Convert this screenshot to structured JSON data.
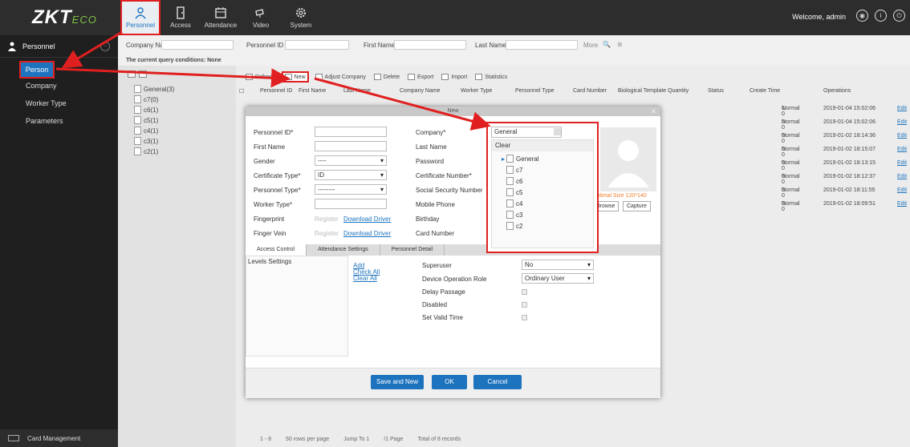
{
  "header": {
    "logo_main": "ZKT",
    "logo_eco": "ECO",
    "modules": [
      {
        "label": "Personnel",
        "icon": "person-icon"
      },
      {
        "label": "Access",
        "icon": "door-icon"
      },
      {
        "label": "Attendance",
        "icon": "calendar-icon"
      },
      {
        "label": "Video",
        "icon": "camera-icon"
      },
      {
        "label": "System",
        "icon": "gear-icon"
      }
    ],
    "welcome": "Welcome, admin"
  },
  "sidebar": {
    "title": "Personnel",
    "items": [
      {
        "label": "Person"
      },
      {
        "label": "Company"
      },
      {
        "label": "Worker Type"
      },
      {
        "label": "Parameters"
      }
    ],
    "footer": "Card Management"
  },
  "query": {
    "company_name": "Company Name",
    "personnel_id": "Personnel ID",
    "first_name": "First Name",
    "last_name": "Last Name",
    "more": "More",
    "conditions": "The current query conditions: None"
  },
  "tree": {
    "nodes": [
      "General(3)",
      "c7(0)",
      "c6(1)",
      "c5(1)",
      "c4(1)",
      "c3(1)",
      "c2(1)"
    ]
  },
  "toolbar": {
    "refresh": "Refresh",
    "new": "New",
    "adjust_company": "Adjust Company",
    "delete": "Delete",
    "export": "Export",
    "import": "Import",
    "statistics": "Statistics"
  },
  "table": {
    "headers": [
      "Personnel ID",
      "First Name",
      "Last Name",
      "Company Name",
      "Worker Type",
      "Personnel Type",
      "Card Number",
      "Biological Template Quantity",
      "Status",
      "Create Time",
      "Operations"
    ],
    "rows": [
      {
        "bio": "1  0",
        "status": "Normal",
        "time": "2019-01-04 15:02:06",
        "op": "Edit"
      },
      {
        "bio": "0  0",
        "status": "Normal",
        "time": "2019-01-04 15:02:06",
        "op": "Edit"
      },
      {
        "bio": "0  0",
        "status": "Normal",
        "time": "2019-01-02 18:14:36",
        "op": "Edit"
      },
      {
        "bio": "0  0",
        "status": "Normal",
        "time": "2019-01-02 18:15:07",
        "op": "Edit"
      },
      {
        "bio": "0  0",
        "status": "Normal",
        "time": "2019-01-02 18:13:15",
        "op": "Edit"
      },
      {
        "bio": "0  0",
        "status": "Normal",
        "time": "2019-01-02 18:12:37",
        "op": "Edit"
      },
      {
        "bio": "0  0",
        "status": "Normal",
        "time": "2019-01-02 18:11:55",
        "op": "Edit"
      },
      {
        "bio": "0  0",
        "status": "Normal",
        "time": "2019-01-02 18:09:51",
        "op": "Edit"
      }
    ]
  },
  "pager": {
    "range": "1 - 8",
    "rows": "50 rows per page",
    "jump": "Jump To",
    "page": "1",
    "pages": "/1 Page",
    "total": "Total of 8 records"
  },
  "dialog": {
    "title": "New",
    "left_labels": [
      "Personnel ID*",
      "First Name",
      "Gender",
      "Certificate Type*",
      "Personnel Type*",
      "Worker Type*",
      "Fingerprint",
      "Finger Vein"
    ],
    "gender_value": "----",
    "cert_value": "ID",
    "ptype_value": "--------",
    "register": "Register",
    "download_driver": "Download Driver",
    "right_labels": [
      "Company*",
      "Last Name",
      "Password",
      "Certificate Number*",
      "Social Security Number",
      "Mobile Phone",
      "Birthday",
      "Card Number"
    ],
    "optimal": "Optimal Size 120*140",
    "browse": "Browse",
    "capture": "Capture",
    "tabs": [
      "Access Control",
      "Attendance Settings",
      "Personnel Detail"
    ],
    "levels": "Levels Settings",
    "add": "Add",
    "check_all": "Check All",
    "clear_all": "Clear All",
    "access_labels": [
      "Superuser",
      "Device Operation Role",
      "Delay Passage",
      "Disabled",
      "Set Valid Time"
    ],
    "superuser_value": "No",
    "role_value": "Ordinary User",
    "save_new": "Save and New",
    "ok": "OK",
    "cancel": "Cancel"
  },
  "company_dropdown": {
    "value": "General",
    "clear": "Clear",
    "nodes": [
      "General",
      "c7",
      "c6",
      "c5",
      "c4",
      "c3",
      "c2"
    ]
  },
  "colors": {
    "accent": "#1e73be",
    "highlight": "#e02020",
    "header": "#2d2d2d"
  }
}
